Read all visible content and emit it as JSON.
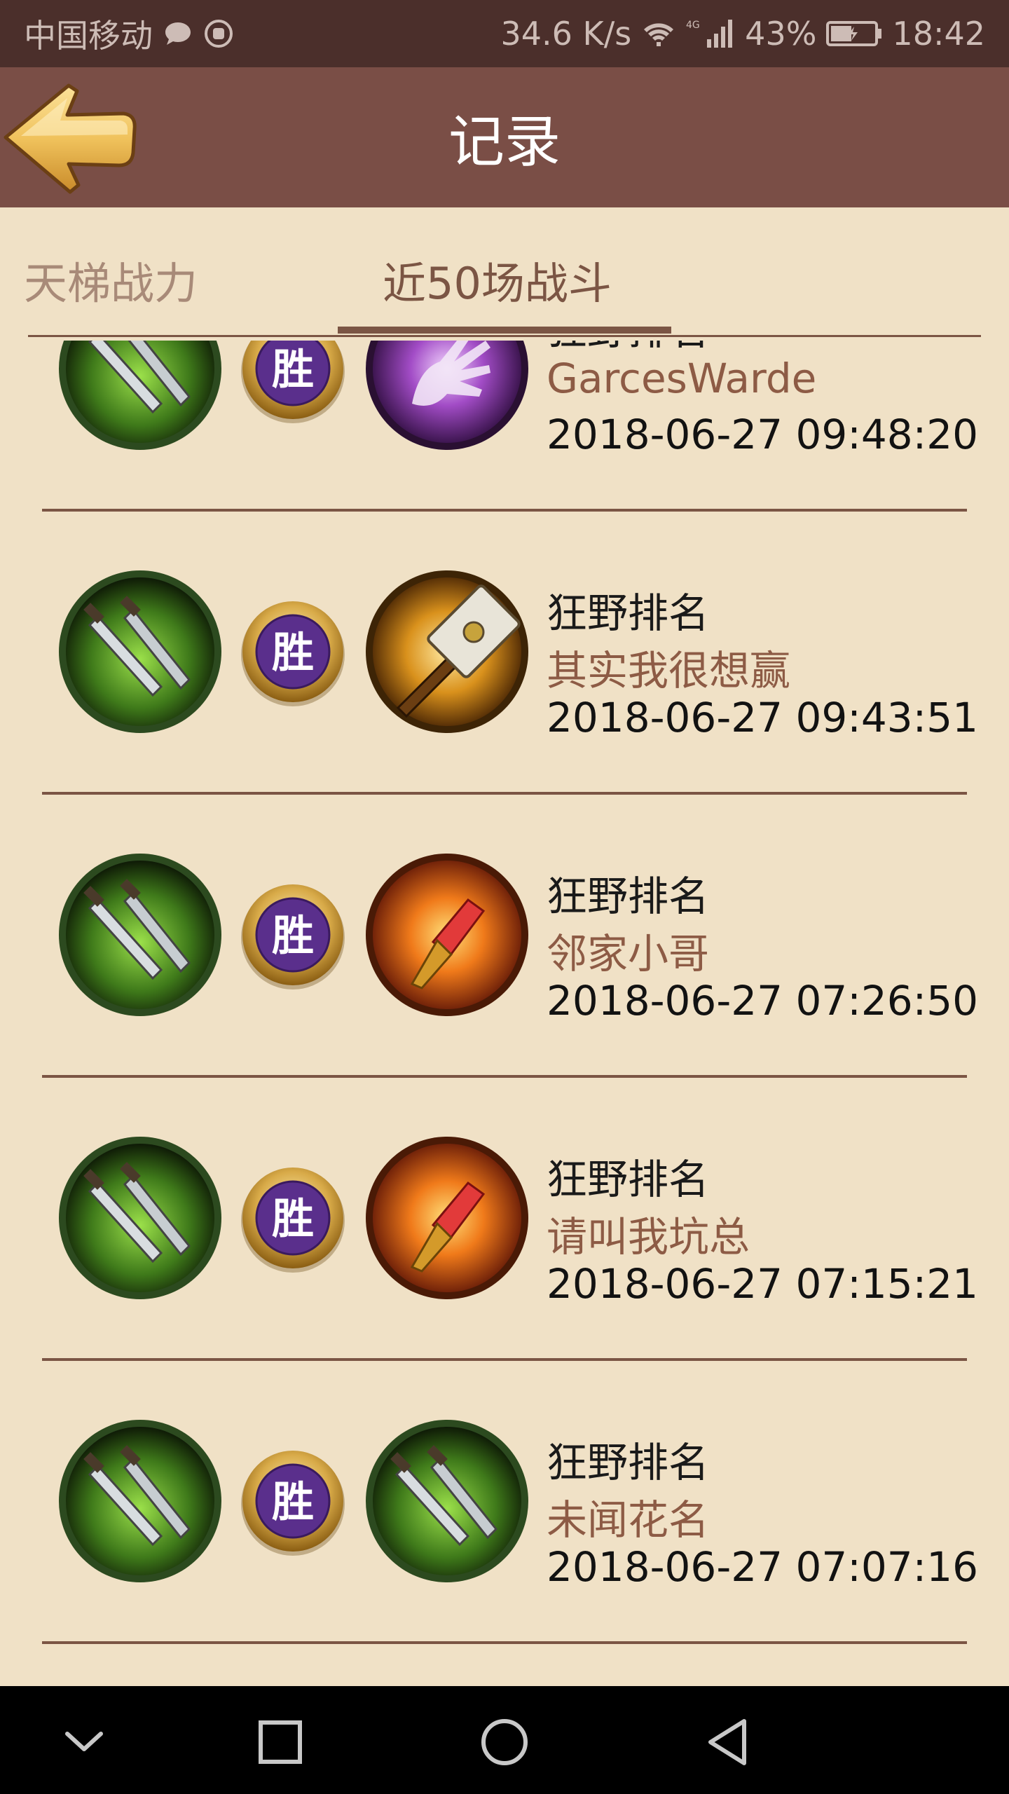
{
  "status_bar": {
    "carrier": "中国移动",
    "speed": "34.6 K/s",
    "network": "4G",
    "battery": "43%",
    "time": "18:42",
    "icons": [
      "message-icon",
      "hand-icon",
      "wifi-icon",
      "signal-icon",
      "battery-icon"
    ]
  },
  "header": {
    "title": "记录",
    "back_icon": "back-arrow-icon"
  },
  "tabs": [
    {
      "label": "天梯战力",
      "active": false
    },
    {
      "label": "近50场战斗",
      "active": true
    }
  ],
  "records": [
    {
      "mode": "狂野排名",
      "opponent": "GarcesWarde",
      "time": "2018-06-27 09:48:20",
      "result": "胜",
      "hero_icon": "blades-icon",
      "enemy_icon": "hand-icon"
    },
    {
      "mode": "狂野排名",
      "opponent": "其实我很想赢",
      "time": "2018-06-27 09:43:51",
      "result": "胜",
      "hero_icon": "blades-icon",
      "enemy_icon": "hammer-icon"
    },
    {
      "mode": "狂野排名",
      "opponent": "邻家小哥",
      "time": "2018-06-27 07:26:50",
      "result": "胜",
      "hero_icon": "blades-icon",
      "enemy_icon": "fire-crystal-icon"
    },
    {
      "mode": "狂野排名",
      "opponent": "请叫我坑总",
      "time": "2018-06-27 07:15:21",
      "result": "胜",
      "hero_icon": "blades-icon",
      "enemy_icon": "fire-crystal-icon"
    },
    {
      "mode": "狂野排名",
      "opponent": "未闻花名",
      "time": "2018-06-27 07:07:16",
      "result": "胜",
      "hero_icon": "blades-icon",
      "enemy_icon": "blades-icon"
    }
  ],
  "nav": {
    "buttons": [
      "nav-down-icon",
      "nav-recents-icon",
      "nav-home-icon",
      "nav-back-icon"
    ]
  }
}
